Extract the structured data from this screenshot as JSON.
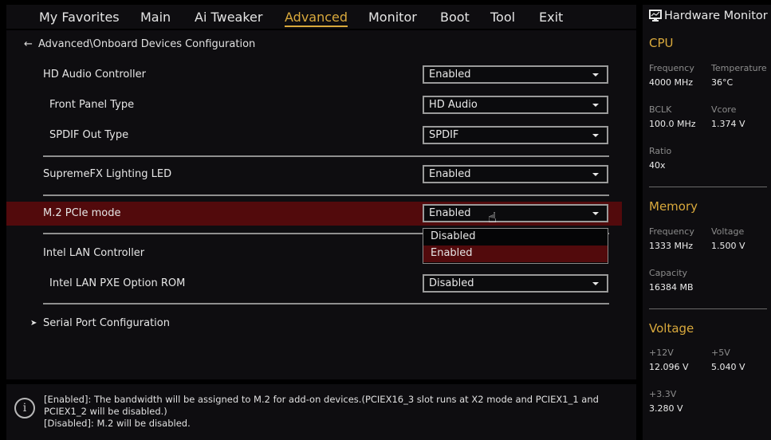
{
  "tabs": [
    "My Favorites",
    "Main",
    "Ai Tweaker",
    "Advanced",
    "Monitor",
    "Boot",
    "Tool",
    "Exit"
  ],
  "active_tab": "Advanced",
  "breadcrumb": "Advanced\\Onboard Devices Configuration",
  "settings": [
    {
      "label": "HD Audio Controller",
      "value": "Enabled"
    },
    {
      "label": "Front Panel Type",
      "value": "HD Audio"
    },
    {
      "label": "SPDIF Out Type",
      "value": "SPDIF"
    },
    {
      "label": "SupremeFX Lighting LED",
      "value": "Enabled"
    },
    {
      "label": "M.2 PCIe mode",
      "value": "Enabled"
    },
    {
      "label": "Intel LAN Controller",
      "value": ""
    },
    {
      "label": "Intel LAN PXE Option ROM",
      "value": "Disabled"
    }
  ],
  "submenu": "Serial Port Configuration",
  "dropdown": {
    "options": [
      "Disabled",
      "Enabled"
    ],
    "selected": "Enabled"
  },
  "help": {
    "line1": "[Enabled]: The bandwidth will be assigned to M.2 for add-on devices.(PCIEX16_3 slot runs at X2 mode and PCIEX1_1 and PCIEX1_2 will be disabled.)",
    "line2": "[Disabled]: M.2 will be disabled."
  },
  "hw": {
    "title": "Hardware Monitor",
    "cpu": {
      "title": "CPU",
      "freq_k": "Frequency",
      "freq_v": "4000 MHz",
      "temp_k": "Temperature",
      "temp_v": "36°C",
      "bclk_k": "BCLK",
      "bclk_v": "100.0 MHz",
      "vcore_k": "Vcore",
      "vcore_v": "1.374 V",
      "ratio_k": "Ratio",
      "ratio_v": "40x"
    },
    "memory": {
      "title": "Memory",
      "freq_k": "Frequency",
      "freq_v": "1333 MHz",
      "volt_k": "Voltage",
      "volt_v": "1.500 V",
      "cap_k": "Capacity",
      "cap_v": "16384 MB"
    },
    "voltage": {
      "title": "Voltage",
      "v12_k": "+12V",
      "v12_v": "12.096 V",
      "v5_k": "+5V",
      "v5_v": "5.040 V",
      "v33_k": "+3.3V",
      "v33_v": "3.280 V"
    }
  },
  "colors": {
    "accent": "#d9a93c",
    "highlight": "#520a0c"
  }
}
